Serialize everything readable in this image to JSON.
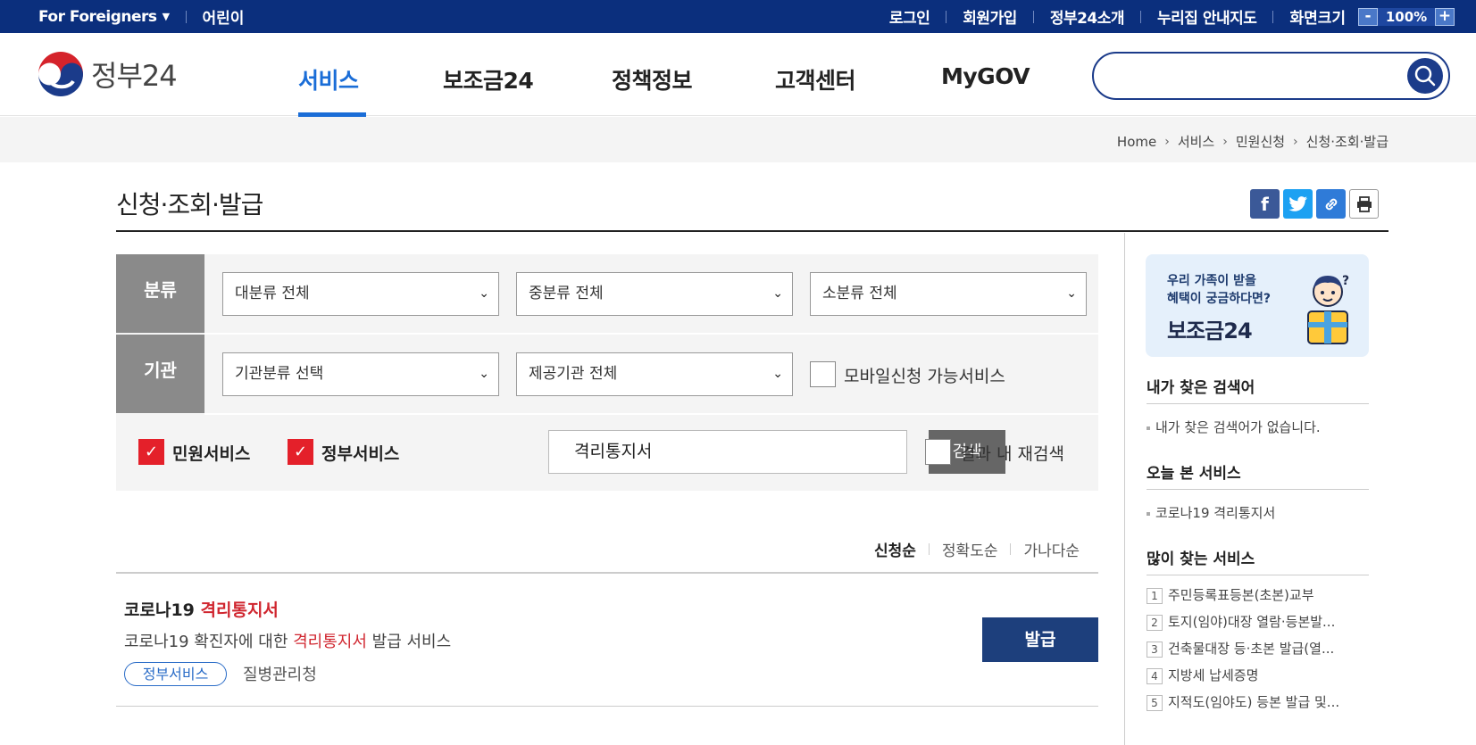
{
  "topbar": {
    "foreigners": "For Foreigners",
    "kids": "어린이",
    "links": [
      "로그인",
      "회원가입",
      "정부24소개",
      "누리집 안내지도"
    ],
    "zoom_label": "화면크기",
    "zoom_minus": "-",
    "zoom_value": "100%",
    "zoom_plus": "+"
  },
  "header": {
    "logo_text": "정부24",
    "nav": [
      "서비스",
      "보조금24",
      "정책정보",
      "고객센터",
      "MyGOV"
    ],
    "active_nav": "서비스",
    "search_placeholder": ""
  },
  "breadcrumb": [
    "Home",
    "서비스",
    "민원신청",
    "신청·조회·발급"
  ],
  "page_title": "신청·조회·발급",
  "filter": {
    "category_label": "분류",
    "category_selects": [
      "대분류 전체",
      "중분류 전체",
      "소분류 전체"
    ],
    "agency_label": "기관",
    "agency_selects": [
      "기관분류 선택",
      "제공기관 전체"
    ],
    "mobile_checkbox": "모바일신청 가능서비스",
    "civil_service_checkbox": "민원서비스",
    "gov_service_checkbox": "정부서비스",
    "keyword": "격리통지서",
    "search_button": "검색",
    "research_checkbox": "결과 내 재검색"
  },
  "sort": [
    "신청순",
    "정확도순",
    "가나다순"
  ],
  "active_sort": "신청순",
  "result": {
    "title_prefix": "코로나19 ",
    "title_highlight": "격리통지서",
    "desc_prefix": "코로나19 확진자에 대한 ",
    "desc_highlight": "격리통지서",
    "desc_suffix": " 발급 서비스",
    "tag": "정부서비스",
    "org": "질병관리청",
    "action": "발급"
  },
  "sidebar": {
    "banner_line1": "우리 가족이 받을",
    "banner_line2": "혜택이 궁금하다면?",
    "banner_big": "보조금24",
    "my_search_title": "내가 찾은 검색어",
    "my_search_empty": "내가 찾은 검색어가 없습니다.",
    "today_title": "오늘 본 서비스",
    "today_items": [
      "코로나19 격리통지서"
    ],
    "popular_title": "많이 찾는 서비스",
    "popular": [
      "주민등록표등본(초본)교부",
      "토지(임야)대장 열람·등본발...",
      "건축물대장 등·초본 발급(열...",
      "지방세 납세증명",
      "지적도(임야도) 등본 발급 및..."
    ]
  }
}
